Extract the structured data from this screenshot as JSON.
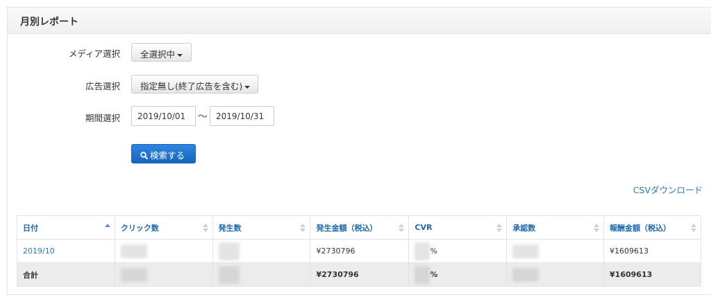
{
  "panel": {
    "title": "月別レポート"
  },
  "form": {
    "media_label": "メディア選択",
    "media_value": "全選択中",
    "ad_label": "広告選択",
    "ad_value": "指定無し(終了広告を含む)",
    "period_label": "期間選択",
    "date_from": "2019/10/01",
    "date_separator": "〜",
    "date_to": "2019/10/31",
    "search_label": "検索する"
  },
  "csv_link": "CSVダウンロード",
  "table": {
    "headers": [
      "日付",
      "クリック数",
      "発生数",
      "発生金額（税込）",
      "CVR",
      "承認数",
      "報酬金額（税込）"
    ],
    "rows": [
      {
        "date": "2019/10",
        "amount": "¥2730796",
        "cvr_suffix": "%",
        "reward": "¥1609613"
      }
    ],
    "total": {
      "label": "合計",
      "amount": "¥2730796",
      "cvr_suffix": "%",
      "reward": "¥1609613"
    }
  }
}
